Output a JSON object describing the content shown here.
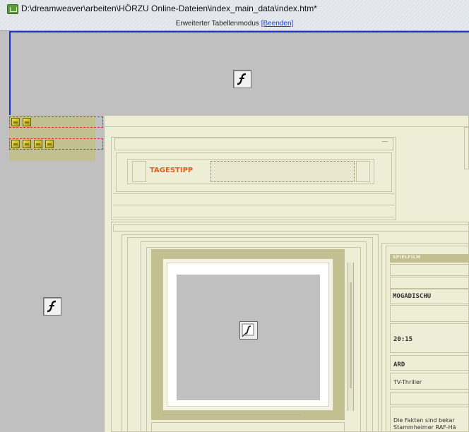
{
  "window": {
    "title": "D:\\dreamweaver\\arbeiten\\HÖRZU Online-Dateien\\index_main_data\\index.htm*",
    "mode_text": "Erweiterter Tabellenmodus ",
    "mode_exit_label": "[Beenden]"
  },
  "icons": {
    "app": "dreamweaver-document-icon",
    "flash_placeholder": "flash-icon",
    "image_placeholder": "image-placeholder-icon",
    "nav_item": "gold-nav-icon"
  },
  "nav_rows": [
    {
      "icon_count": 2
    },
    {
      "icon_count": 4
    }
  ],
  "tagestipp": {
    "label": "TAGESTIPP"
  },
  "program_info": {
    "badge": "SPIELFILM",
    "title": "MOGADISCHU",
    "time": "20:15",
    "channel": "ARD",
    "genre": "TV-Thriller",
    "description_line1": "Die Fakten sind bekar",
    "description_line2": "Stammheimer RAF-Hä"
  },
  "colors": {
    "table_bg": "#eeedd6",
    "olive": "#c2bf90",
    "placeholder_gray": "#c0c0c0",
    "accent_orange": "#e0601c",
    "selection_blue": "#1c2fd0"
  }
}
